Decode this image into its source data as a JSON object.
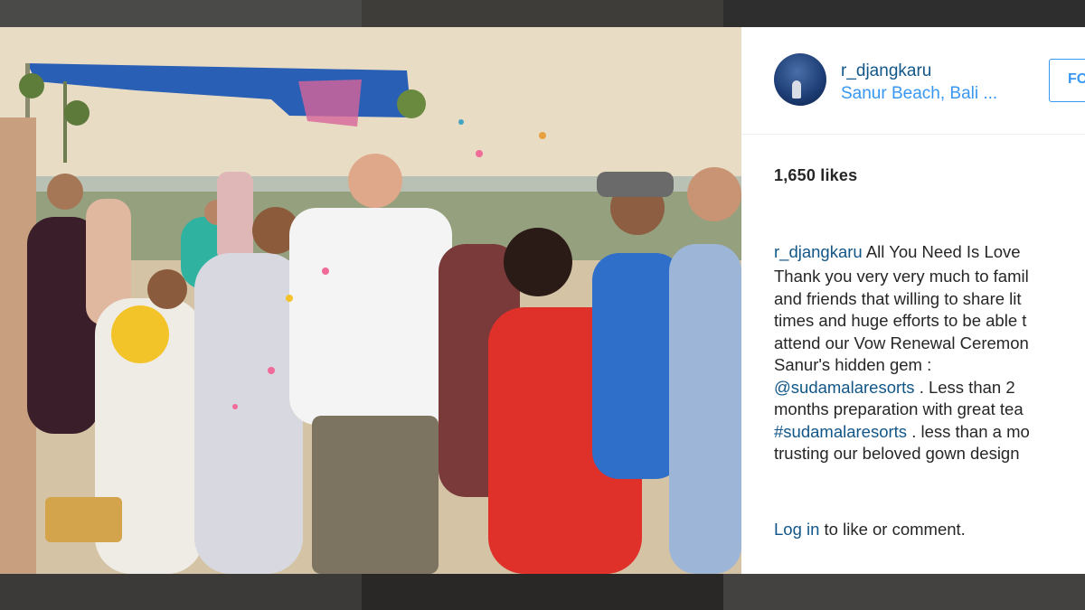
{
  "post": {
    "username": "r_djangkaru",
    "location": "Sanur Beach, Bali ...",
    "follow_label": "FO",
    "likes": "1,650 likes",
    "caption_user": "r_djangkaru",
    "caption_text": "All You Need Is Love",
    "body_lines": [
      "Thank you very very much to famil",
      "and friends that willing to share lit",
      "times and huge efforts to be able t",
      "attend our Vow Renewal Ceremon",
      "Sanur's hidden gem :"
    ],
    "mention": "@sudamalaresorts",
    "mention_after": ". Less than 2",
    "line_after_mention": "months preparation with great tea",
    "hashtag": "#sudamalaresorts",
    "hashtag_after": ". less than a mo",
    "last_line": "trusting our beloved gown design",
    "login_link": "Log in",
    "login_rest": " to like or comment."
  },
  "icons": {
    "avatar": "profile-photo"
  }
}
